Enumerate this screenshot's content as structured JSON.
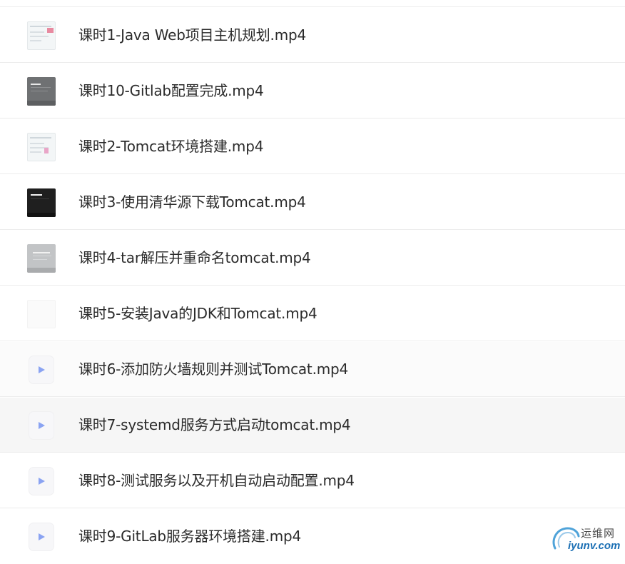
{
  "files": [
    {
      "name": "课时1-Java Web项目主机规划.mp4",
      "thumbnail": "screenshot-light-thumbnail"
    },
    {
      "name": "课时10-Gitlab配置完成.mp4",
      "thumbnail": "screenshot-gray-thumbnail"
    },
    {
      "name": "课时2-Tomcat环境搭建.mp4",
      "thumbnail": "screenshot-light-thumbnail"
    },
    {
      "name": "课时3-使用清华源下载Tomcat.mp4",
      "thumbnail": "screenshot-dark-thumbnail"
    },
    {
      "name": "课时4-tar解压并重命名tomcat.mp4",
      "thumbnail": "screenshot-silver-thumbnail"
    },
    {
      "name": "课时5-安装Java的JDK和Tomcat.mp4",
      "thumbnail": "blank-thumbnail"
    },
    {
      "name": "课时6-添加防火墙规则并测试Tomcat.mp4",
      "thumbnail": "video-file-icon"
    },
    {
      "name": "课时7-systemd服务方式启动tomcat.mp4",
      "thumbnail": "video-file-icon"
    },
    {
      "name": "课时8-测试服务以及开机自动启动配置.mp4",
      "thumbnail": "video-file-icon"
    },
    {
      "name": "课时9-GitLab服务器环境搭建.mp4",
      "thumbnail": "video-file-icon"
    }
  ],
  "watermark": {
    "name_cn": "运维网",
    "domain": "iyunv.com"
  },
  "colors": {
    "text": "#2b2b2b",
    "divider": "#ececec",
    "play_icon": "#8aa3f2",
    "watermark_blue": "#1b6fb4"
  }
}
